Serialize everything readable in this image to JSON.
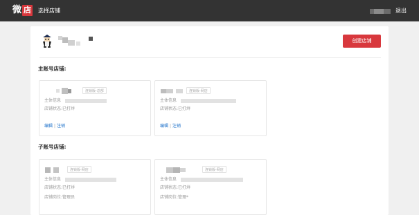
{
  "header": {
    "logo_wei": "微",
    "logo_dian": "店",
    "page_name": "选择店铺",
    "logout": "退出"
  },
  "account": {
    "create_button": "创建店铺"
  },
  "main_section": {
    "title": "主账号店铺:",
    "stores": [
      {
        "badge": "连锁版-总部",
        "subject_label": "主体信息",
        "status": "店铺状态:已打烊",
        "edit": "编辑",
        "separator": "|",
        "cancel": "注销"
      },
      {
        "badge": "连锁版-网店",
        "subject_label": "主体信息",
        "status": "店铺状态:已打烊",
        "edit": "编辑",
        "separator": "|",
        "cancel": "注销"
      }
    ]
  },
  "sub_section": {
    "title": "子账号店铺:",
    "stores": [
      {
        "badge": "连锁版-网店",
        "subject_label": "主体信息",
        "status": "店铺状态:已打烊",
        "role": "店铺岗位:管理员"
      },
      {
        "badge": "连锁版-网店",
        "subject_label": "主体信息",
        "status": "店铺状态:已打烊",
        "role": "店铺岗位:管理*"
      }
    ]
  }
}
